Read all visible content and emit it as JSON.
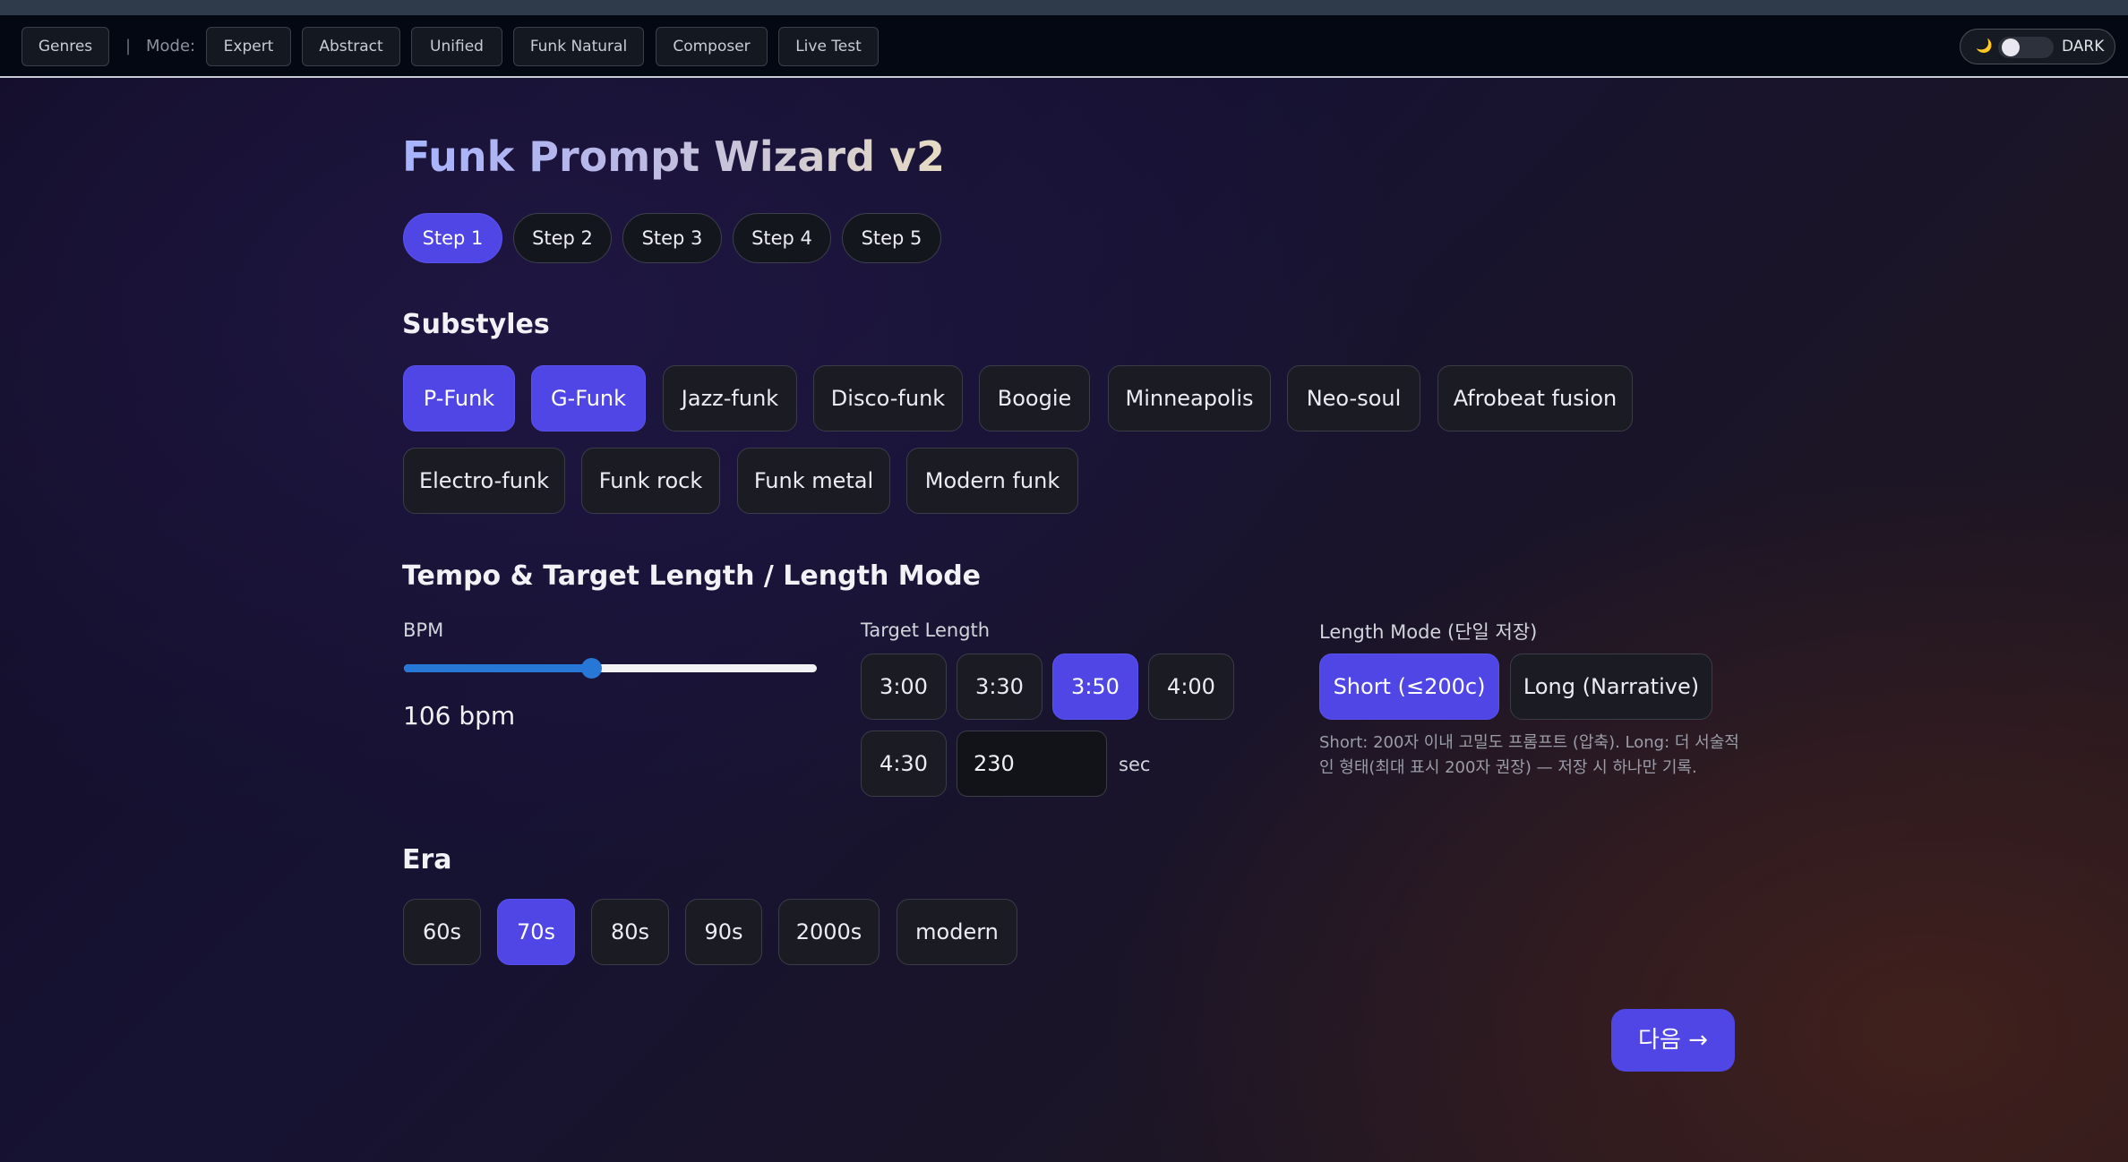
{
  "nav": {
    "genres": "Genres",
    "separator": "|",
    "mode_label": "Mode:",
    "modes": [
      "Expert",
      "Abstract",
      "Unified",
      "Funk Natural",
      "Composer",
      "Live Test"
    ],
    "theme_icon": "moon-icon",
    "theme_label": "DARK",
    "theme_dark": true
  },
  "title": "Funk Prompt Wizard v2",
  "steps": [
    "Step 1",
    "Step 2",
    "Step 3",
    "Step 4",
    "Step 5"
  ],
  "active_step": "Step 1",
  "substyles": {
    "heading": "Substyles",
    "options": [
      "P-Funk",
      "G-Funk",
      "Jazz-funk",
      "Disco-funk",
      "Boogie",
      "Minneapolis",
      "Neo-soul",
      "Afrobeat fusion",
      "Electro-funk",
      "Funk rock",
      "Funk metal",
      "Modern funk"
    ],
    "selected": [
      "P-Funk",
      "G-Funk"
    ]
  },
  "tempo": {
    "heading": "Tempo & Target Length / Length Mode",
    "bpm_label": "BPM",
    "bpm_value": "106 bpm",
    "slider_fraction": 0.45,
    "target_label": "Target Length",
    "target_options": [
      "3:00",
      "3:30",
      "3:50",
      "4:00",
      "4:30"
    ],
    "target_selected": "3:50",
    "seconds_value": "230",
    "seconds_unit": "sec",
    "length_mode_label": "Length Mode (단일 저장)",
    "length_modes": [
      "Short (≤200c)",
      "Long (Narrative)"
    ],
    "length_mode_selected": "Short (≤200c)",
    "hint": "Short: 200자 이내 고밀도 프롬프트 (압축). Long: 더 서술적인 형태(최대 표시 200자 권장) — 저장 시 하나만 기록."
  },
  "era": {
    "heading": "Era",
    "options": [
      "60s",
      "70s",
      "80s",
      "90s",
      "2000s",
      "modern"
    ],
    "selected": "70s"
  },
  "next_button": "다음 →",
  "colors": {
    "accent": "#4f46e5",
    "slider": "#2677d6",
    "nav_bg": "#040812"
  }
}
